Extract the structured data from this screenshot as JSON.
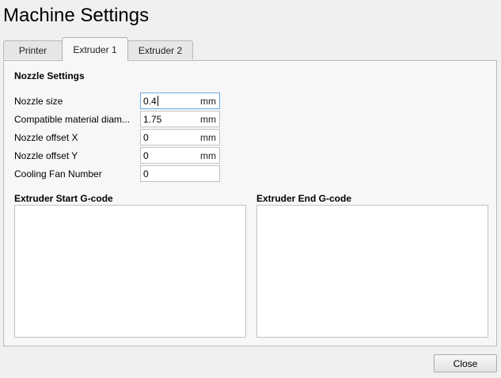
{
  "window": {
    "title": "Machine Settings"
  },
  "tabs": [
    {
      "label": "Printer",
      "active": false
    },
    {
      "label": "Extruder 1",
      "active": true
    },
    {
      "label": "Extruder 2",
      "active": false
    }
  ],
  "nozzle_settings": {
    "title": "Nozzle Settings",
    "fields": [
      {
        "label": "Nozzle size",
        "value": "0.4",
        "unit": "mm",
        "focused": true
      },
      {
        "label": "Compatible material diam...",
        "value": "1.75",
        "unit": "mm"
      },
      {
        "label": "Nozzle offset X",
        "value": "0",
        "unit": "mm"
      },
      {
        "label": "Nozzle offset Y",
        "value": "0",
        "unit": "mm"
      },
      {
        "label": "Cooling Fan Number",
        "value": "0",
        "unit": ""
      }
    ]
  },
  "gcode": {
    "start": {
      "title": "Extruder Start G-code",
      "value": ""
    },
    "end": {
      "title": "Extruder End G-code",
      "value": ""
    }
  },
  "buttons": {
    "close": "Close"
  }
}
